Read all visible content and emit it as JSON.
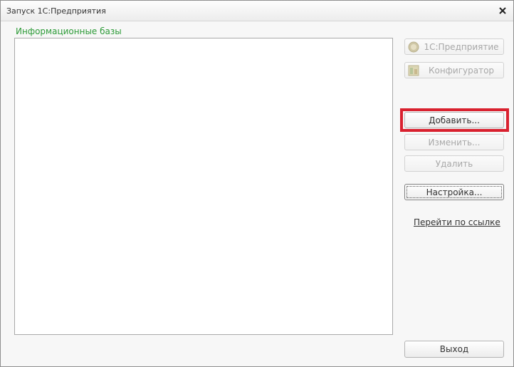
{
  "window": {
    "title": "Запуск 1С:Предприятия",
    "close_icon": "close-icon"
  },
  "infobases": {
    "label": "Информационные базы",
    "items": []
  },
  "buttons": {
    "enterprise": {
      "label": "1С:Предприятие",
      "icon": "enterprise-icon",
      "enabled": false
    },
    "configurator": {
      "label": "Конфигуратор",
      "icon": "configurator-icon",
      "enabled": false
    },
    "add": {
      "label": "Добавить...",
      "enabled": true,
      "highlighted": true
    },
    "edit": {
      "label": "Изменить...",
      "enabled": false
    },
    "delete": {
      "label": "Удалить",
      "enabled": false
    },
    "settings": {
      "label": "Настройка...",
      "enabled": true,
      "focused": true
    },
    "exit": {
      "label": "Выход",
      "enabled": true
    }
  },
  "link": {
    "label": "Перейти по ссылке"
  },
  "colors": {
    "label_green": "#2d9b38",
    "highlight_red": "#d9212f"
  }
}
